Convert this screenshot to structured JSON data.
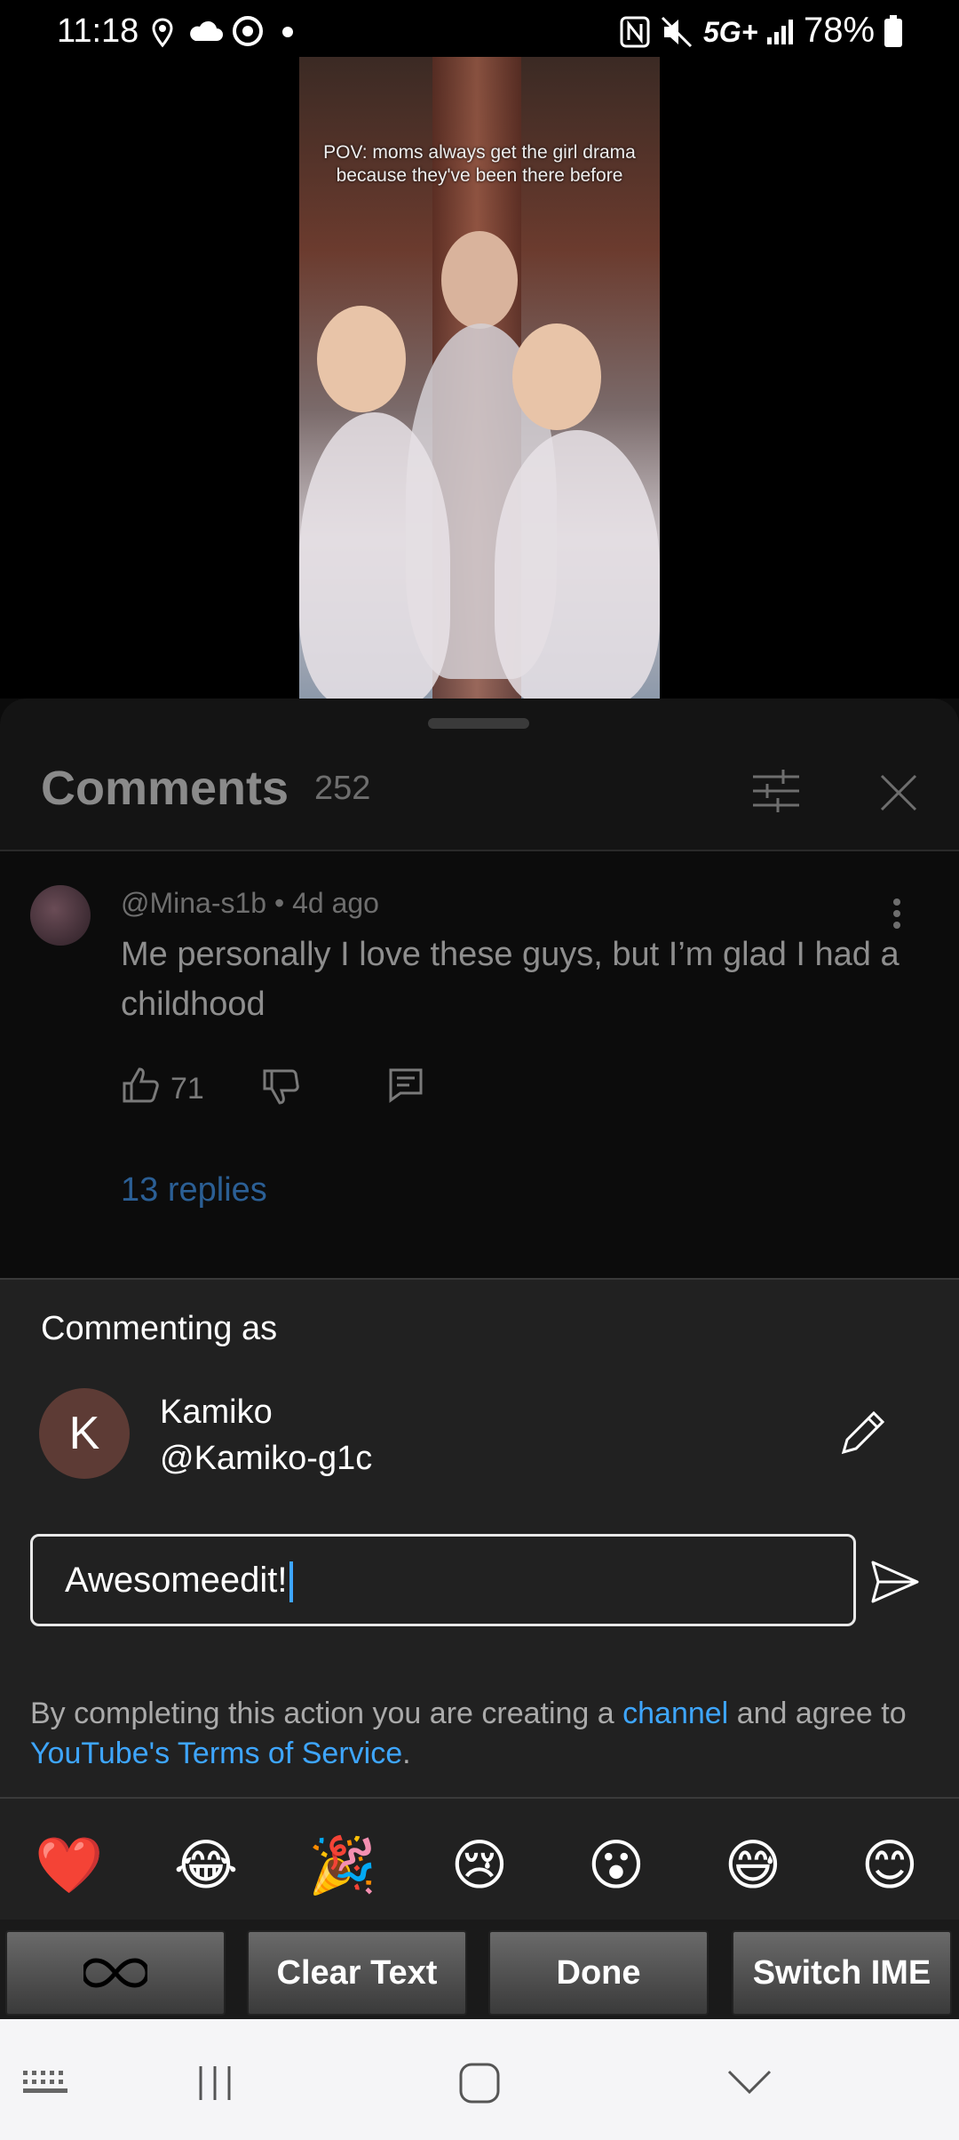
{
  "status_bar": {
    "time": "11:18",
    "network": "5G+",
    "battery": "78%"
  },
  "video": {
    "caption": "POV: moms always get the girl drama because they've been there before"
  },
  "comments": {
    "title": "Comments",
    "count": "252",
    "items": [
      {
        "author_meta": "@Mina-s1b • 4d ago",
        "text": "Me personally I love these guys, but I’m glad I had a childhood",
        "likes": "71",
        "replies": "13 replies"
      }
    ]
  },
  "composer": {
    "commenting_as_label": "Commenting as",
    "avatar_initial": "K",
    "user_name": "Kamiko",
    "user_handle": "@Kamiko-g1c",
    "input_value": "Awesomeedit!",
    "terms_prefix": "By completing this action you are creating a ",
    "terms_channel_link": "channel",
    "terms_middle": " and agree to ",
    "terms_tos_link": "YouTube's Terms of Service",
    "terms_suffix": "."
  },
  "emojis": [
    "❤️",
    "😂",
    "🎉",
    "😢",
    "😮",
    "😅",
    "😊"
  ],
  "tools": {
    "clear_text": "Clear Text",
    "done": "Done",
    "switch_ime": "Switch IME"
  },
  "colors": {
    "link": "#3ea6ff",
    "panel": "#212121",
    "replies_dimmed": "#2b5f95"
  }
}
